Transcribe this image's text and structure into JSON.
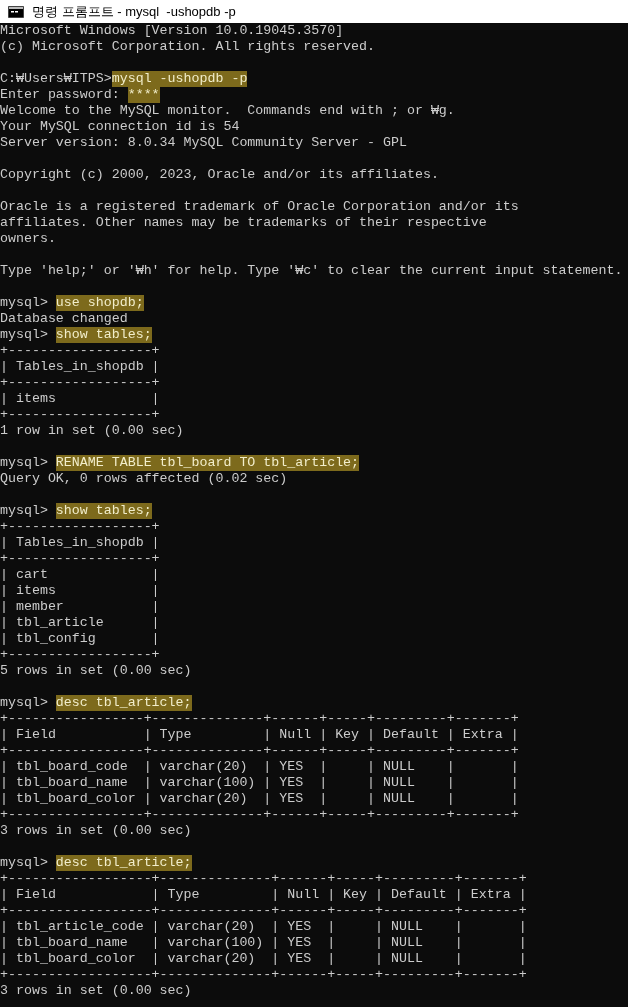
{
  "window": {
    "title": "명령 프롬프트 - mysql  -ushopdb -p"
  },
  "console": [
    {
      "kind": "text",
      "text": "Microsoft Windows [Version 10.0.19045.3570]"
    },
    {
      "kind": "text",
      "text": "(c) Microsoft Corporation. All rights reserved."
    },
    {
      "kind": "blank"
    },
    {
      "kind": "input",
      "prompt": "C:₩Users₩ITPS>",
      "command": "mysql -ushopdb -p",
      "highlighted": true
    },
    {
      "kind": "input",
      "prompt": "Enter password: ",
      "command": "****",
      "highlighted": true
    },
    {
      "kind": "text",
      "text": "Welcome to the MySQL monitor.  Commands end with ; or ₩g."
    },
    {
      "kind": "text",
      "text": "Your MySQL connection id is 54"
    },
    {
      "kind": "text",
      "text": "Server version: 8.0.34 MySQL Community Server - GPL"
    },
    {
      "kind": "blank"
    },
    {
      "kind": "text",
      "text": "Copyright (c) 2000, 2023, Oracle and/or its affiliates."
    },
    {
      "kind": "blank"
    },
    {
      "kind": "text",
      "text": "Oracle is a registered trademark of Oracle Corporation and/or its"
    },
    {
      "kind": "text",
      "text": "affiliates. Other names may be trademarks of their respective"
    },
    {
      "kind": "text",
      "text": "owners."
    },
    {
      "kind": "blank"
    },
    {
      "kind": "text",
      "text": "Type 'help;' or '₩h' for help. Type '₩c' to clear the current input statement."
    },
    {
      "kind": "blank"
    },
    {
      "kind": "input",
      "prompt": "mysql> ",
      "command": "use shopdb;",
      "highlighted": true
    },
    {
      "kind": "text",
      "text": "Database changed"
    },
    {
      "kind": "input",
      "prompt": "mysql> ",
      "command": "show tables;",
      "highlighted": true
    },
    {
      "kind": "text",
      "text": "+------------------+"
    },
    {
      "kind": "text",
      "text": "| Tables_in_shopdb |"
    },
    {
      "kind": "text",
      "text": "+------------------+"
    },
    {
      "kind": "text",
      "text": "| items            |"
    },
    {
      "kind": "text",
      "text": "+------------------+"
    },
    {
      "kind": "text",
      "text": "1 row in set (0.00 sec)"
    },
    {
      "kind": "blank"
    },
    {
      "kind": "input",
      "prompt": "mysql> ",
      "command": "RENAME TABLE tbl_board TO tbl_article;",
      "highlighted": true
    },
    {
      "kind": "text",
      "text": "Query OK, 0 rows affected (0.02 sec)"
    },
    {
      "kind": "blank"
    },
    {
      "kind": "input",
      "prompt": "mysql> ",
      "command": "show tables;",
      "highlighted": true
    },
    {
      "kind": "text",
      "text": "+------------------+"
    },
    {
      "kind": "text",
      "text": "| Tables_in_shopdb |"
    },
    {
      "kind": "text",
      "text": "+------------------+"
    },
    {
      "kind": "text",
      "text": "| cart             |"
    },
    {
      "kind": "text",
      "text": "| items            |"
    },
    {
      "kind": "text",
      "text": "| member           |"
    },
    {
      "kind": "text",
      "text": "| tbl_article      |"
    },
    {
      "kind": "text",
      "text": "| tbl_config       |"
    },
    {
      "kind": "text",
      "text": "+------------------+"
    },
    {
      "kind": "text",
      "text": "5 rows in set (0.00 sec)"
    },
    {
      "kind": "blank"
    },
    {
      "kind": "input",
      "prompt": "mysql> ",
      "command": "desc tbl_article;",
      "highlighted": true
    },
    {
      "kind": "text",
      "text": "+-----------------+--------------+------+-----+---------+-------+"
    },
    {
      "kind": "text",
      "text": "| Field           | Type         | Null | Key | Default | Extra |"
    },
    {
      "kind": "text",
      "text": "+-----------------+--------------+------+-----+---------+-------+"
    },
    {
      "kind": "text",
      "text": "| tbl_board_code  | varchar(20)  | YES  |     | NULL    |       |"
    },
    {
      "kind": "text",
      "text": "| tbl_board_name  | varchar(100) | YES  |     | NULL    |       |"
    },
    {
      "kind": "text",
      "text": "| tbl_board_color | varchar(20)  | YES  |     | NULL    |       |"
    },
    {
      "kind": "text",
      "text": "+-----------------+--------------+------+-----+---------+-------+"
    },
    {
      "kind": "text",
      "text": "3 rows in set (0.00 sec)"
    },
    {
      "kind": "blank"
    },
    {
      "kind": "input",
      "prompt": "mysql> ",
      "command": "desc tbl_article;",
      "highlighted": true
    },
    {
      "kind": "text",
      "text": "+------------------+--------------+------+-----+---------+-------+"
    },
    {
      "kind": "text",
      "text": "| Field            | Type         | Null | Key | Default | Extra |"
    },
    {
      "kind": "text",
      "text": "+------------------+--------------+------+-----+---------+-------+"
    },
    {
      "kind": "text",
      "text": "| tbl_article_code | varchar(20)  | YES  |     | NULL    |       |"
    },
    {
      "kind": "text",
      "text": "| tbl_board_name   | varchar(100) | YES  |     | NULL    |       |"
    },
    {
      "kind": "text",
      "text": "| tbl_board_color  | varchar(20)  | YES  |     | NULL    |       |"
    },
    {
      "kind": "text",
      "text": "+------------------+--------------+------+-----+---------+-------+"
    },
    {
      "kind": "text",
      "text": "3 rows in set (0.00 sec)"
    }
  ]
}
